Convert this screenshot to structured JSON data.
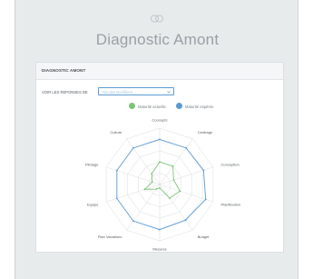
{
  "header": {
    "icon": "link-icon",
    "title": "Diagnostic Amont"
  },
  "card": {
    "header": "DIAGNOSTIC AMONT",
    "filter_label": "VOIR LES REPONSES DE",
    "select_value": "Nicolas Bonfiliere"
  },
  "colors": {
    "actual": "#7cc576",
    "expected": "#5b9bd5",
    "grid": "#d9dcdf"
  },
  "chart_data": {
    "type": "radar",
    "axes": [
      "Concepts",
      "Centrage",
      "Conception",
      "Planification",
      "Budget",
      "Mesures",
      "Plan Vacations",
      "Equipe",
      "Pilotage",
      "Culture"
    ],
    "levels": 5,
    "max": 5,
    "series": [
      {
        "name": "Maturité actuelle",
        "color_key": "actual",
        "values": [
          2.0,
          2.0,
          1.3,
          1.9,
          1.5,
          0.3,
          0.5,
          1.4,
          0.7,
          1.2
        ]
      },
      {
        "name": "Maturité espérée",
        "color_key": "expected",
        "values": [
          4.0,
          4.0,
          4.1,
          4.3,
          3.9,
          4.0,
          4.0,
          4.0,
          4.0,
          4.0
        ]
      }
    ]
  }
}
